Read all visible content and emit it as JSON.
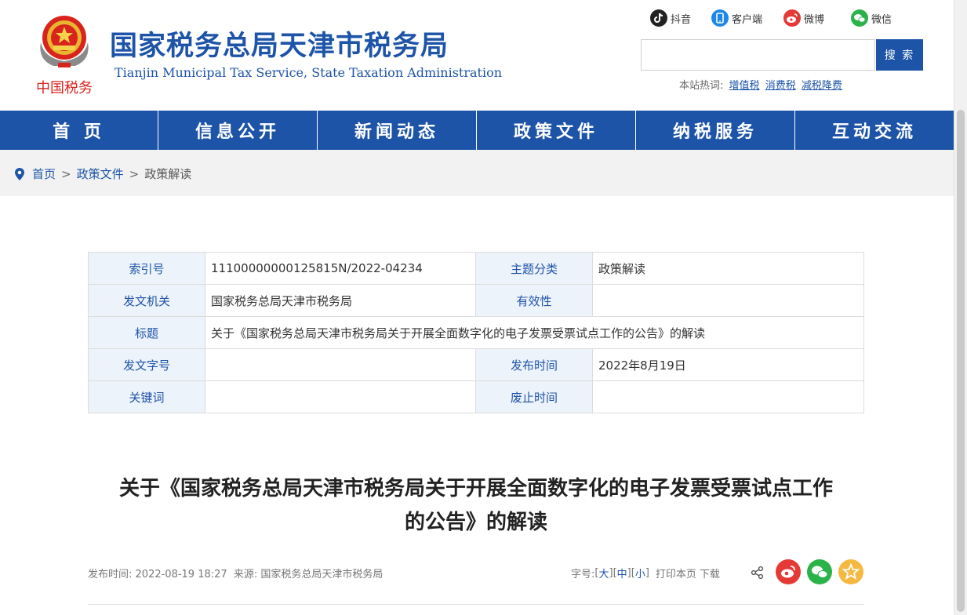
{
  "header": {
    "emblem_text": "中国税务",
    "title": "国家税务总局天津市税务局",
    "subtitle": "Tianjin Municipal Tax Service, State Taxation Administration",
    "social": [
      {
        "label": "抖音",
        "icon": "douyin-icon",
        "color": "#222222"
      },
      {
        "label": "客户端",
        "icon": "client-app-icon",
        "color": "#1e88e5"
      },
      {
        "label": "微博",
        "icon": "weibo-icon",
        "color": "#e53935"
      },
      {
        "label": "微信",
        "icon": "wechat-icon",
        "color": "#2bb34a"
      }
    ],
    "search": {
      "placeholder": "",
      "button": "搜 索"
    },
    "hot": {
      "label": "本站热词:",
      "words": [
        "增值税",
        "消费税",
        "减税降费"
      ]
    }
  },
  "nav": [
    "首 页",
    "信息公开",
    "新闻动态",
    "政策文件",
    "纳税服务",
    "互动交流"
  ],
  "breadcrumb": {
    "items": [
      "首页",
      "政策文件",
      "政策解读"
    ],
    "separator": ">"
  },
  "info": {
    "index_label": "索引号",
    "index_value": "11100000000125815N/2022-04234",
    "topic_label": "主题分类",
    "topic_value": "政策解读",
    "issuer_label": "发文机关",
    "issuer_value": "国家税务总局天津市税务局",
    "validity_label": "有效性",
    "validity_value": "",
    "title_label": "标题",
    "title_value": "关于《国家税务总局天津市税务局关于开展全面数字化的电子发票受票试点工作的公告》的解读",
    "docno_label": "发文字号",
    "docno_value": "",
    "date_label": "发布时间",
    "date_value": "2022年8月19日",
    "keywords_label": "关键词",
    "keywords_value": "",
    "abolish_label": "废止时间",
    "abolish_value": ""
  },
  "article": {
    "title_line1": "关于《国家税务总局天津市税务局关于开展全面数字化的电子发票受票试点工作",
    "title_line2": "的公告》的解读",
    "meta_time_label": "发布时间:",
    "meta_time": "2022-08-19 18:27",
    "meta_source_label": "来源:",
    "meta_source": "国家税务总局天津市税务局",
    "font_label": "字号:",
    "font_sizes": [
      "大",
      "中",
      "小"
    ],
    "print": "打印本页",
    "download": "下载"
  },
  "colors": {
    "brand": "#1d54a8",
    "label_bg": "#edf3fb",
    "weibo": "#e53935",
    "wechat": "#2bb34a",
    "favorite": "#f5b942"
  }
}
